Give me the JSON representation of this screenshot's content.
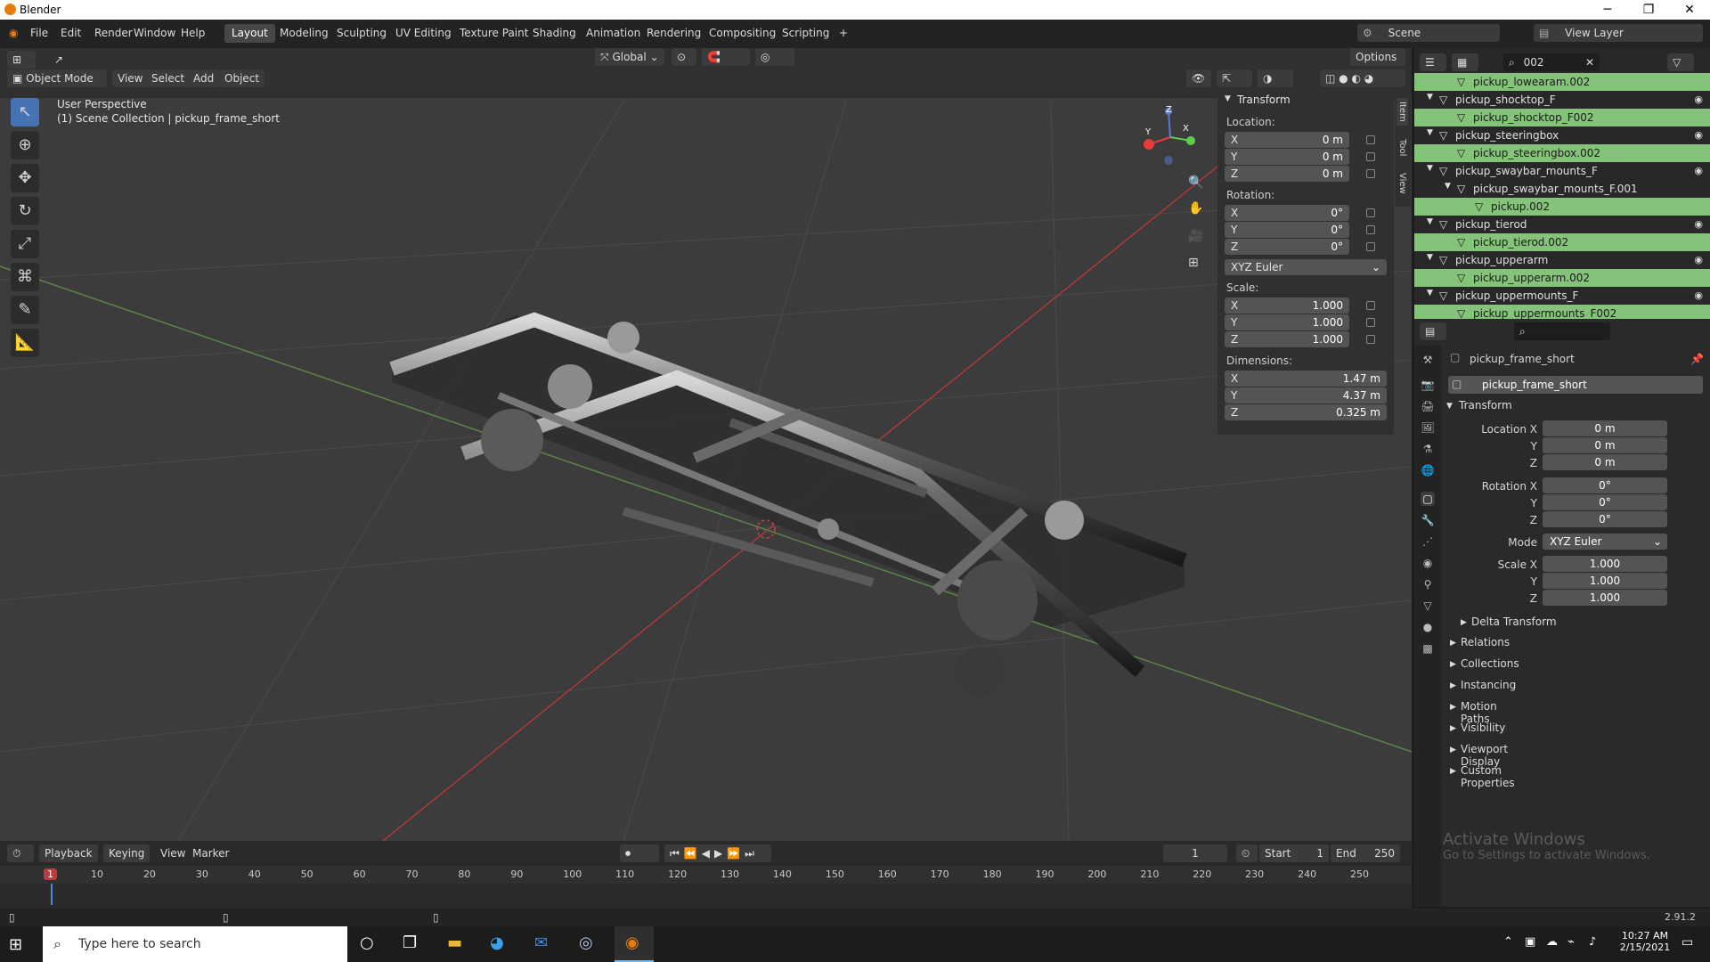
{
  "window": {
    "title": "Blender"
  },
  "menu": [
    "File",
    "Edit",
    "Render",
    "Window",
    "Help"
  ],
  "workspaces": [
    "Layout",
    "Modeling",
    "Sculpting",
    "UV Editing",
    "Texture Paint",
    "Shading",
    "Animation",
    "Rendering",
    "Compositing",
    "Scripting",
    "+"
  ],
  "top_right": {
    "scene": "Scene",
    "view_layer": "View Layer"
  },
  "viewport_header": {
    "transform_orientation": "Global",
    "options": "Options",
    "mode": "Object Mode",
    "menus": [
      "View",
      "Select",
      "Add",
      "Object"
    ]
  },
  "viewport_overlay": {
    "line1": "User Perspective",
    "line2": "(1) Scene Collection | pickup_frame_short"
  },
  "gizmo": {
    "x": "X",
    "y": "Y",
    "z": "Z"
  },
  "npanel": {
    "title": "Transform",
    "location_label": "Location:",
    "location": [
      {
        "axis": "X",
        "value": "0 m"
      },
      {
        "axis": "Y",
        "value": "0 m"
      },
      {
        "axis": "Z",
        "value": "0 m"
      }
    ],
    "rotation_label": "Rotation:",
    "rotation": [
      {
        "axis": "X",
        "value": "0°"
      },
      {
        "axis": "Y",
        "value": "0°"
      },
      {
        "axis": "Z",
        "value": "0°"
      }
    ],
    "rotation_mode": "XYZ Euler",
    "scale_label": "Scale:",
    "scale": [
      {
        "axis": "X",
        "value": "1.000"
      },
      {
        "axis": "Y",
        "value": "1.000"
      },
      {
        "axis": "Z",
        "value": "1.000"
      }
    ],
    "dimensions_label": "Dimensions:",
    "dimensions": [
      {
        "axis": "X",
        "value": "1.47 m"
      },
      {
        "axis": "Y",
        "value": "4.37 m"
      },
      {
        "axis": "Z",
        "value": "0.325 m"
      }
    ],
    "tabs": [
      "Item",
      "Tool",
      "View"
    ]
  },
  "outliner": {
    "search": "002",
    "rows": [
      {
        "label": "pickup_lowearam.002",
        "sel": true,
        "indent": 2,
        "eye": false,
        "tri": ""
      },
      {
        "label": "pickup_shocktop_F",
        "sel": false,
        "indent": 1,
        "eye": true,
        "tri": "▼"
      },
      {
        "label": "pickup_shocktop_F002",
        "sel": true,
        "indent": 2,
        "eye": false,
        "tri": ""
      },
      {
        "label": "pickup_steeringbox",
        "sel": false,
        "indent": 1,
        "eye": true,
        "tri": "▼"
      },
      {
        "label": "pickup_steeringbox.002",
        "sel": true,
        "indent": 2,
        "eye": false,
        "tri": ""
      },
      {
        "label": "pickup_swaybar_mounts_F",
        "sel": false,
        "indent": 1,
        "eye": true,
        "tri": "▼"
      },
      {
        "label": "pickup_swaybar_mounts_F.001",
        "sel": false,
        "indent": 2,
        "eye": false,
        "tri": "▼"
      },
      {
        "label": "pickup.002",
        "sel": true,
        "indent": 3,
        "eye": false,
        "tri": ""
      },
      {
        "label": "pickup_tierod",
        "sel": false,
        "indent": 1,
        "eye": true,
        "tri": "▼"
      },
      {
        "label": "pickup_tierod.002",
        "sel": true,
        "indent": 2,
        "eye": false,
        "tri": ""
      },
      {
        "label": "pickup_upperarm",
        "sel": false,
        "indent": 1,
        "eye": true,
        "tri": "▼"
      },
      {
        "label": "pickup_upperarm.002",
        "sel": true,
        "indent": 2,
        "eye": false,
        "tri": ""
      },
      {
        "label": "pickup_uppermounts_F",
        "sel": false,
        "indent": 1,
        "eye": true,
        "tri": "▼"
      },
      {
        "label": "pickup_uppermounts_F002",
        "sel": true,
        "indent": 2,
        "eye": false,
        "tri": ""
      }
    ]
  },
  "properties": {
    "object_name": "pickup_frame_short",
    "name_field": "pickup_frame_short",
    "transform": "Transform",
    "location_x_label": "Location X",
    "y_label": "Y",
    "z_label": "Z",
    "location": [
      "0 m",
      "0 m",
      "0 m"
    ],
    "rotation_x_label": "Rotation X",
    "rotation": [
      "0°",
      "0°",
      "0°"
    ],
    "mode_label": "Mode",
    "mode": "XYZ Euler",
    "scale_x_label": "Scale X",
    "scale": [
      "1.000",
      "1.000",
      "1.000"
    ],
    "delta": "Delta Transform",
    "sections": [
      "Relations",
      "Collections",
      "Instancing",
      "Motion Paths",
      "Visibility",
      "Viewport Display",
      "Custom Properties"
    ]
  },
  "timeline": {
    "menus": [
      "Playback",
      "Keying",
      "View",
      "Marker"
    ],
    "current_frame": "1",
    "start_label": "Start",
    "start": "1",
    "end_label": "End",
    "end": "250",
    "ruler": [
      "1",
      "10",
      "20",
      "30",
      "40",
      "50",
      "60",
      "70",
      "80",
      "90",
      "100",
      "110",
      "120",
      "130",
      "140",
      "150",
      "160",
      "170",
      "180",
      "190",
      "200",
      "210",
      "220",
      "230",
      "240",
      "250"
    ]
  },
  "watermark": {
    "line1": "Activate Windows",
    "line2": "Go to Settings to activate Windows."
  },
  "status": {
    "version": "2.91.2"
  },
  "taskbar": {
    "search_placeholder": "Type here to search",
    "time": "10:27 AM",
    "date": "2/15/2021"
  }
}
